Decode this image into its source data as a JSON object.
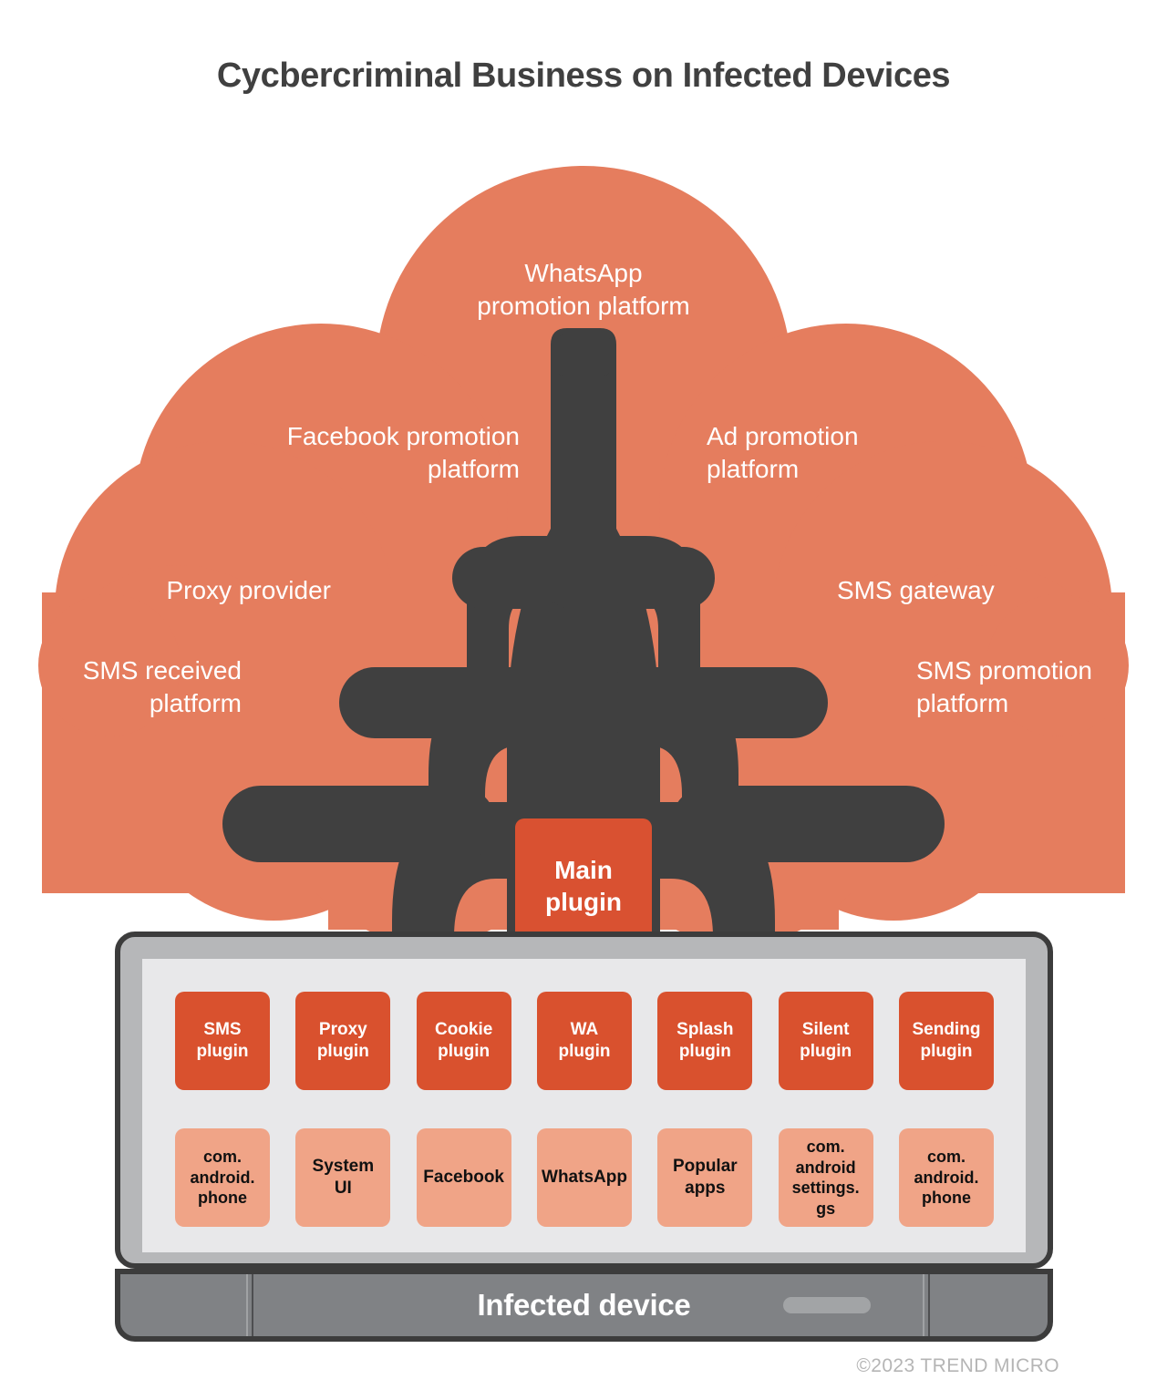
{
  "title": "Cycbercriminal Business on Infected Devices",
  "colors": {
    "cloud": "#E57D5E",
    "tree": "#404040",
    "main_plugin": "#D95131",
    "plugin_cell": "#D9512E",
    "app_cell": "#F0A487",
    "device_bezel": "#B6B7B9",
    "device_screen": "#E8E8EA",
    "device_bottom": "#808285",
    "title_text": "#404040",
    "copyright_text": "#B5B5B5"
  },
  "branches": [
    {
      "id": "whatsapp-promotion-platform",
      "label": "WhatsApp\npromotion platform"
    },
    {
      "id": "facebook-promotion-platform",
      "label": "Facebook promotion\nplatform"
    },
    {
      "id": "ad-promotion-platform",
      "label": "Ad promotion\nplatform"
    },
    {
      "id": "proxy-provider",
      "label": "Proxy provider"
    },
    {
      "id": "sms-gateway",
      "label": "SMS gateway"
    },
    {
      "id": "sms-received-platform",
      "label": "SMS received\nplatform"
    },
    {
      "id": "sms-promotion-platform",
      "label": "SMS promotion\nplatform"
    }
  ],
  "branch_labels": {
    "whatsapp": "WhatsApp\npromotion platform",
    "facebook": "Facebook promotion\nplatform",
    "ad": "Ad promotion\nplatform",
    "proxy": "Proxy provider",
    "sms_gateway": "SMS gateway",
    "sms_received": "SMS received\nplatform",
    "sms_promotion": "SMS promotion\nplatform"
  },
  "main_plugin": {
    "label": "Main\nplugin"
  },
  "device": {
    "label": "Infected device",
    "plugins": [
      {
        "label": "SMS\nplugin"
      },
      {
        "label": "Proxy\nplugin"
      },
      {
        "label": "Cookie\nplugin"
      },
      {
        "label": "WA\nplugin"
      },
      {
        "label": "Splash\nplugin"
      },
      {
        "label": "Silent\nplugin"
      },
      {
        "label": "Sending\nplugin"
      }
    ],
    "apps": [
      {
        "label": "com.\nandroid.\nphone"
      },
      {
        "label": "System\nUI"
      },
      {
        "label": "Facebook"
      },
      {
        "label": "WhatsApp"
      },
      {
        "label": "Popular\napps"
      },
      {
        "label": "com.\nandroid\nsettings.\ngs"
      },
      {
        "label": "com.\nandroid.\nphone"
      }
    ]
  },
  "copyright": "©2023 TREND MICRO"
}
